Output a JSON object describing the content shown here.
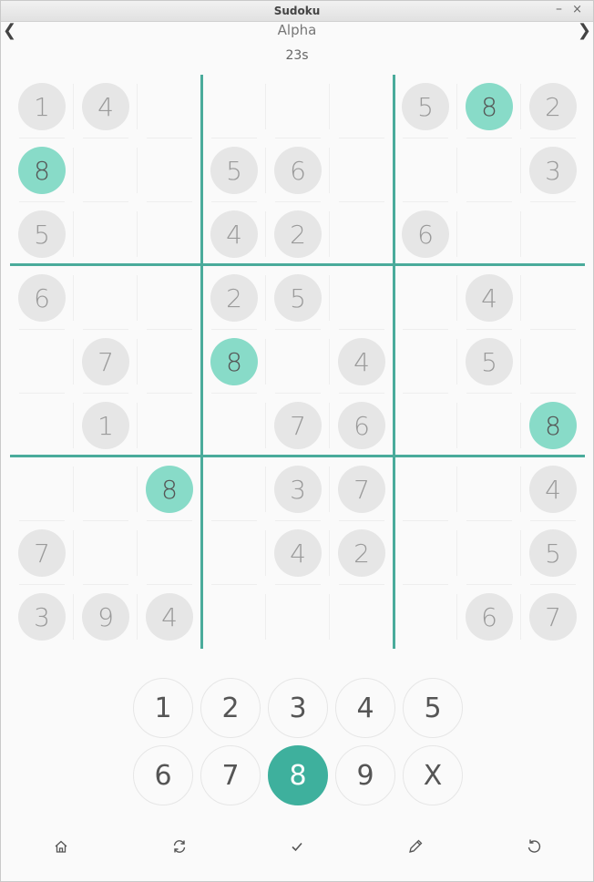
{
  "window": {
    "title": "Sudoku",
    "minimize_label": "–",
    "close_label": "×"
  },
  "header": {
    "prev_label": "❮",
    "next_label": "❯",
    "puzzle_name": "Alpha",
    "timer": "23s"
  },
  "grid": [
    [
      "1",
      "4",
      "",
      "",
      "",
      "",
      "5",
      "8",
      "2"
    ],
    [
      "8",
      "",
      "",
      "5",
      "6",
      "",
      "",
      "",
      "3"
    ],
    [
      "5",
      "",
      "",
      "4",
      "2",
      "",
      "6",
      "",
      ""
    ],
    [
      "6",
      "",
      "",
      "2",
      "5",
      "",
      "",
      "4",
      ""
    ],
    [
      "",
      "7",
      "",
      "8",
      "",
      "4",
      "",
      "5",
      ""
    ],
    [
      "",
      "1",
      "",
      "",
      "7",
      "6",
      "",
      "",
      "8"
    ],
    [
      "",
      "",
      "8",
      "",
      "3",
      "7",
      "",
      "",
      "4"
    ],
    [
      "7",
      "",
      "",
      "",
      "4",
      "2",
      "",
      "",
      "5"
    ],
    [
      "3",
      "9",
      "4",
      "",
      "",
      "",
      "",
      "6",
      "7"
    ]
  ],
  "highlight_digit": "8",
  "number_pad": {
    "row1": [
      "1",
      "2",
      "3",
      "4",
      "5"
    ],
    "row2": [
      "6",
      "7",
      "8",
      "9",
      "X"
    ],
    "selected": "8"
  },
  "toolbar": [
    "home-icon",
    "refresh-icon",
    "check-icon",
    "pencil-icon",
    "undo-icon"
  ],
  "colors": {
    "accent": "#4aab9b",
    "highlight": "#88dbc8",
    "selected_key": "#3eb09d",
    "given": "#e6e6e6"
  }
}
